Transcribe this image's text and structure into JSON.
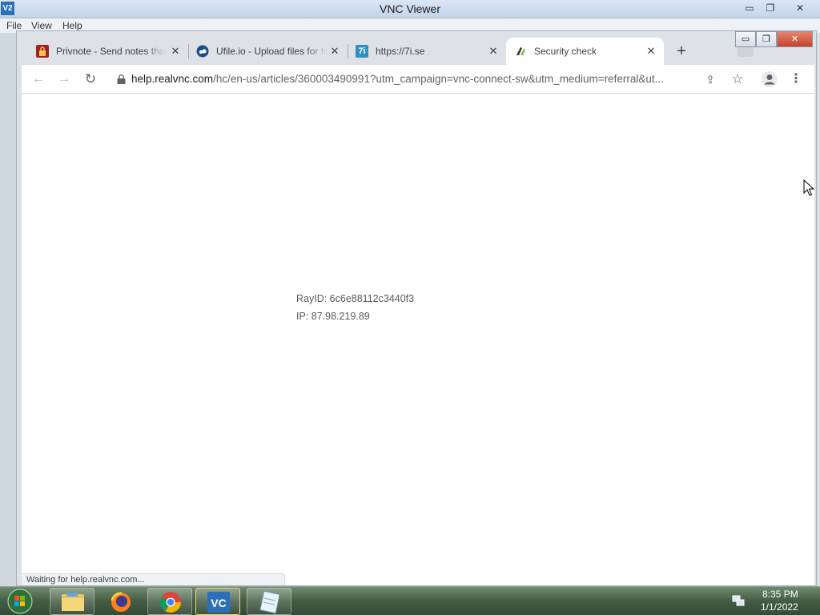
{
  "vnc": {
    "app_icon": "V2",
    "title": "VNC Viewer",
    "menus": {
      "file": "File",
      "view": "View",
      "help": "Help"
    },
    "window_controls": {
      "minimize": "▭",
      "maximize": "❐",
      "close": "✕"
    }
  },
  "browser": {
    "tabs": [
      {
        "title": "Privnote - Send notes that self-destruct",
        "favicon": "privnote-lock-icon",
        "favicon_color": "#a32020",
        "active": false
      },
      {
        "title": "Ufile.io - Upload files for free",
        "favicon": "ufile-cloud-icon",
        "favicon_color": "#1b4f8c",
        "active": false
      },
      {
        "title": "https://7i.se",
        "favicon": "7i-logo-icon",
        "favicon_text": "7i",
        "favicon_color": "#2d8fc4",
        "active": false
      },
      {
        "title": "Security check",
        "favicon": "cloudflare-loading-icon",
        "favicon_color": "#4caf50",
        "active": true
      }
    ],
    "tab_close_glyph": "✕",
    "new_tab_glyph": "+",
    "window_controls": {
      "minimize": "▭",
      "maximize": "❐",
      "close": "✕"
    },
    "toolbar": {
      "back": "←",
      "forward": "→",
      "reload": "↻",
      "url_host": "help.realvnc.com",
      "url_path": "/hc/en-us/articles/360003490991?utm_campaign=vnc-connect-sw&utm_medium=referral&ut...",
      "share": "⇪",
      "bookmark": "☆",
      "menu": "⋮"
    },
    "page": {
      "ray_id": "RayID: 6c6e88112c3440f3",
      "ip": "IP: 87.98.219.89"
    },
    "status_text": "Waiting for help.realvnc.com..."
  },
  "taskbar": {
    "apps": [
      "start-orb-icon",
      "explorer-folder-icon",
      "firefox-icon",
      "chrome-icon",
      "vnc-viewer-icon",
      "notepad-icon"
    ],
    "clock_time": "8:35 PM",
    "clock_date": "1/1/2022"
  }
}
